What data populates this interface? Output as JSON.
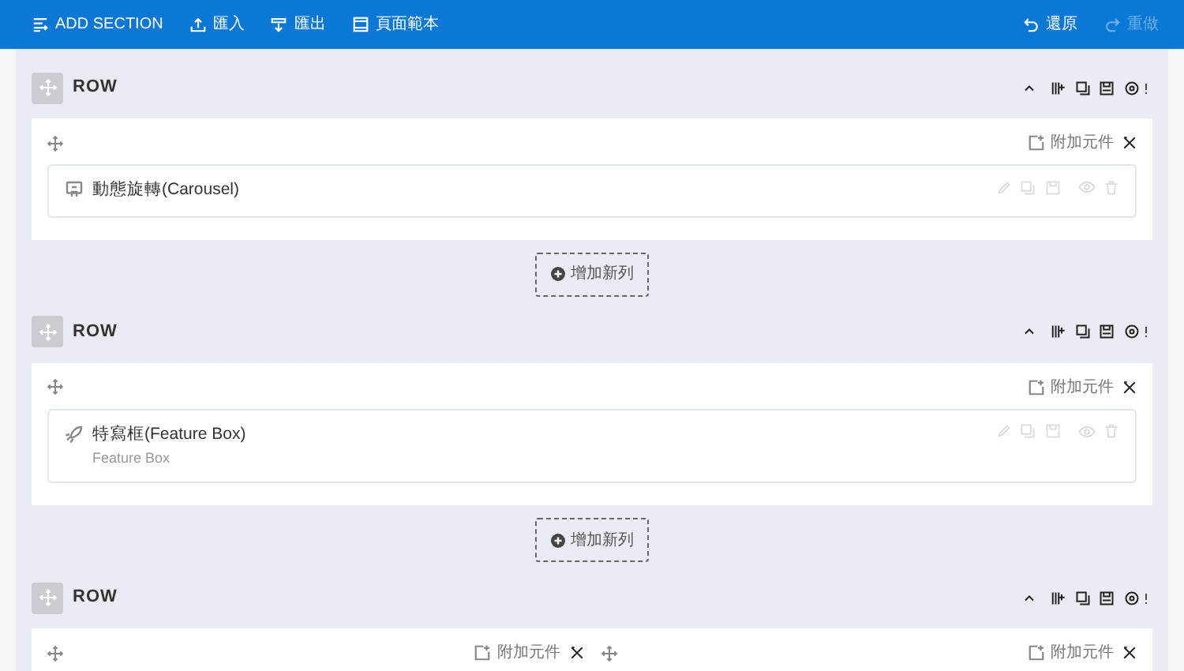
{
  "toolbar": {
    "left": [
      {
        "kind": "section",
        "label": "ADD SECTION"
      },
      {
        "kind": "import",
        "label": "匯入"
      },
      {
        "kind": "export",
        "label": "匯出"
      },
      {
        "kind": "template",
        "label": "頁面範本"
      }
    ],
    "right": [
      {
        "kind": "undo",
        "label": "還原",
        "disabled": false
      },
      {
        "kind": "redo",
        "label": "重做",
        "disabled": true
      }
    ]
  },
  "sections": [
    {
      "title": "ROW",
      "add_row": "增加新列",
      "columns": [
        {
          "add_label": "附加元件",
          "elements": [
            {
              "kind": "carousel",
              "title": "動態旋轉(Carousel)"
            }
          ]
        }
      ]
    },
    {
      "title": "ROW",
      "add_row": "增加新列",
      "columns": [
        {
          "add_label": "附加元件",
          "elements": [
            {
              "kind": "featurebox",
              "title": "特寫框(Feature Box)",
              "subtitle": "Feature Box"
            }
          ]
        }
      ]
    },
    {
      "title": "ROW",
      "columns": [
        {
          "add_label": "附加元件"
        },
        {
          "add_label": "附加元件"
        }
      ]
    }
  ]
}
